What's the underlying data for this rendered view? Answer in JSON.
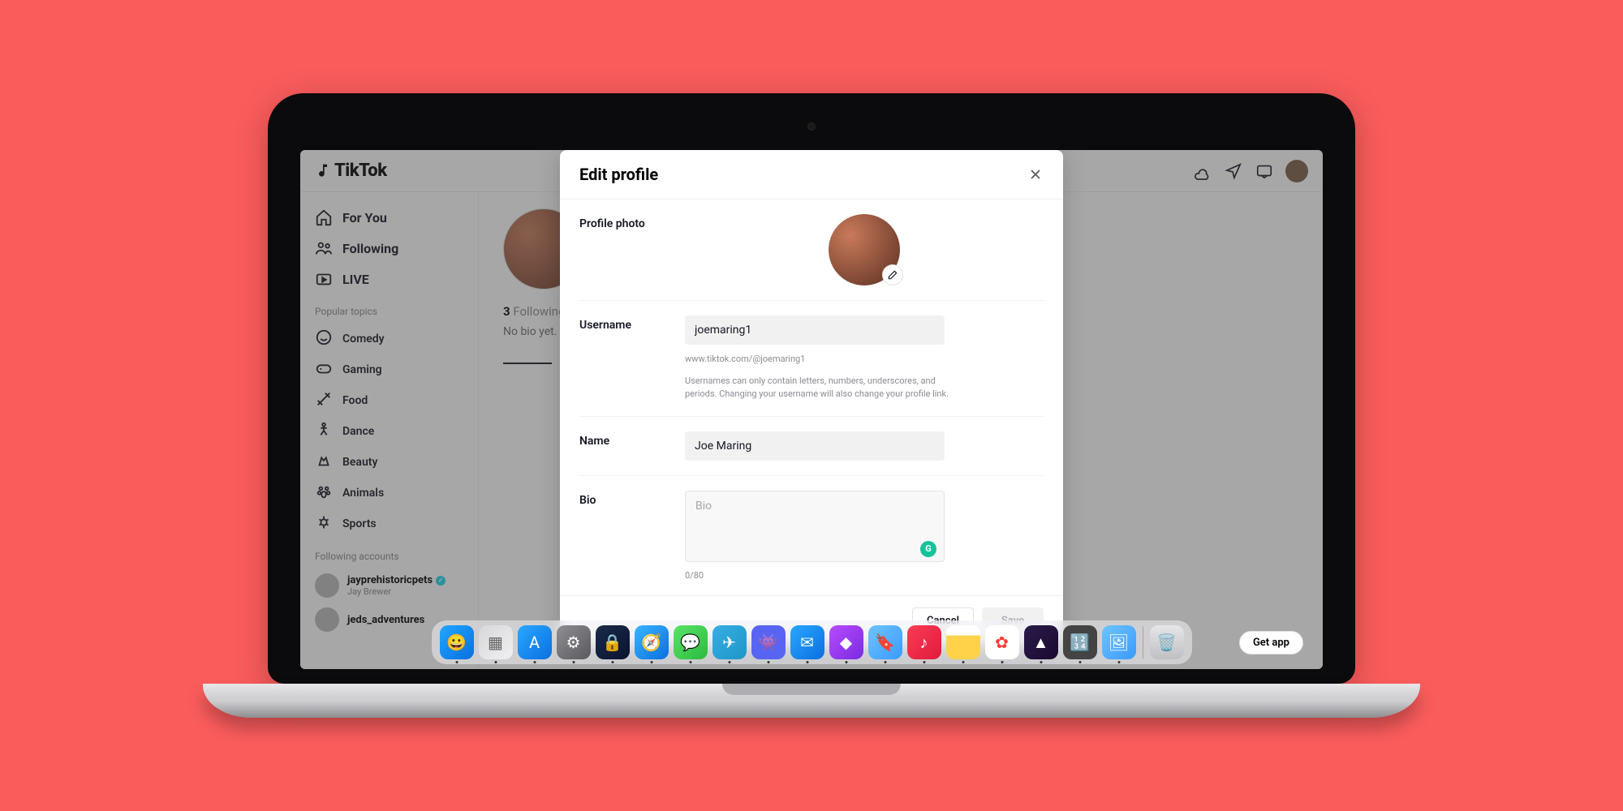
{
  "app_name": "TikTok",
  "header_icons": [
    "upload-icon",
    "send-icon",
    "inbox-icon",
    "avatar"
  ],
  "sidebar": {
    "nav": [
      {
        "key": "foryou",
        "label": "For You"
      },
      {
        "key": "following",
        "label": "Following"
      },
      {
        "key": "live",
        "label": "LIVE"
      }
    ],
    "topics_label": "Popular topics",
    "topics": [
      {
        "key": "comedy",
        "label": "Comedy"
      },
      {
        "key": "gaming",
        "label": "Gaming"
      },
      {
        "key": "food",
        "label": "Food"
      },
      {
        "key": "dance",
        "label": "Dance"
      },
      {
        "key": "beauty",
        "label": "Beauty"
      },
      {
        "key": "animals",
        "label": "Animals"
      },
      {
        "key": "sports",
        "label": "Sports"
      }
    ],
    "following_label": "Following accounts",
    "following": [
      {
        "username": "jayprehistoricpets",
        "display": "Jay Brewer",
        "verified": true
      },
      {
        "username": "jeds_adventures",
        "display": "",
        "verified": false
      }
    ]
  },
  "profile": {
    "following_count": "3",
    "following_label": "Following",
    "no_bio": "No bio yet."
  },
  "get_app_label": "Get app",
  "modal": {
    "title": "Edit profile",
    "photo_label": "Profile photo",
    "username_label": "Username",
    "username_value": "joemaring1",
    "url_preview": "www.tiktok.com/@joemaring1",
    "username_help": "Usernames can only contain letters, numbers, underscores, and periods. Changing your username will also change your profile link.",
    "name_label": "Name",
    "name_value": "Joe Maring",
    "bio_label": "Bio",
    "bio_placeholder": "Bio",
    "bio_value": "",
    "char_count": "0/80",
    "cancel": "Cancel",
    "save": "Save"
  },
  "dock": {
    "apps": [
      {
        "name": "finder",
        "bg": "linear-gradient(135deg,#1fa7ff,#0a6fe0)",
        "glyph": "😀"
      },
      {
        "name": "launchpad",
        "bg": "linear-gradient(135deg,#d7d7da,#f0f0f2)",
        "glyph": "▦"
      },
      {
        "name": "appstore",
        "bg": "linear-gradient(135deg,#2aa8ff,#0a6fe0)",
        "glyph": "A"
      },
      {
        "name": "settings",
        "bg": "linear-gradient(135deg,#8e8e93,#5a5a5e)",
        "glyph": "⚙"
      },
      {
        "name": "1password",
        "bg": "linear-gradient(135deg,#1a2a4a,#0a1430)",
        "glyph": "🔒"
      },
      {
        "name": "safari",
        "bg": "linear-gradient(135deg,#3ab4ff,#0a6fe0)",
        "glyph": "🧭"
      },
      {
        "name": "messages",
        "bg": "linear-gradient(135deg,#5be36a,#2bbb3e)",
        "glyph": "💬"
      },
      {
        "name": "telegram",
        "bg": "linear-gradient(135deg,#37aee2,#1e96c8)",
        "glyph": "✈"
      },
      {
        "name": "discord",
        "bg": "#5865f2",
        "glyph": "👾"
      },
      {
        "name": "spark",
        "bg": "linear-gradient(135deg,#2aa8ff,#0a6fe0)",
        "glyph": "✉"
      },
      {
        "name": "affinity",
        "bg": "linear-gradient(135deg,#b84bff,#7a2be0)",
        "glyph": "◆"
      },
      {
        "name": "reading",
        "bg": "linear-gradient(135deg,#6fc3ff,#3a9bff)",
        "glyph": "🔖"
      },
      {
        "name": "music",
        "bg": "linear-gradient(135deg,#fa3c55,#e01b3c)",
        "glyph": "♪"
      },
      {
        "name": "notes",
        "bg": "linear-gradient(to bottom,#fff 30%,#ffd24a 30%)",
        "glyph": ""
      },
      {
        "name": "photos",
        "bg": "#fff",
        "glyph": "✿"
      },
      {
        "name": "pixelmator",
        "bg": "linear-gradient(135deg,#2a1a4a,#1a0a30)",
        "glyph": "▲"
      },
      {
        "name": "calculator",
        "bg": "#444",
        "glyph": "🔢"
      },
      {
        "name": "preview",
        "bg": "linear-gradient(135deg,#6fc3ff,#3a9bff)",
        "glyph": "🖼"
      }
    ],
    "trash": {
      "name": "trash",
      "glyph": "🗑"
    }
  }
}
